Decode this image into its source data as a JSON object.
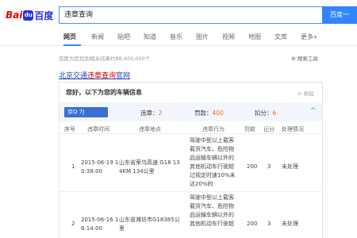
{
  "logo": {
    "bai": "Bai",
    "paw": "du",
    "du": "百度"
  },
  "search": {
    "query": "违章查询",
    "button": "百度一"
  },
  "tabs": [
    "网页",
    "新闻",
    "贴吧",
    "知道",
    "音乐",
    "图片",
    "视频",
    "地图",
    "文库",
    "更多»"
  ],
  "result_count": "百度为您找到相关结果约88,600,000个",
  "search_tools": "搜索工具",
  "result": {
    "title_pre": "北京交通",
    "title_hl": "违章查询",
    "title_post": "官网"
  },
  "card": {
    "heading": "您好，以下为您的车辆信息",
    "fold": "收起",
    "plate": "京Q 7J",
    "violations_label": "违章：",
    "violations": "2",
    "fine_label": "罚款：",
    "fine": "400",
    "points_label": "扣分：",
    "points": "6",
    "caret": "^",
    "headers": [
      "序号",
      "违章时间",
      "违章地点",
      "违章行为",
      "罚款",
      "记分",
      "处理情况"
    ],
    "rows": [
      {
        "no": "1",
        "time": [
          "2015-06-19 1",
          "3:38:00"
        ],
        "place": [
          "山东省荣乌高速 G18 13",
          "4KM 134公里"
        ],
        "behavior": [
          "驾驶中型以上载客",
          "载货汽车、危险物",
          "品运输车辆以外的",
          "其他机动车行驶超",
          "过规定时速10%未",
          "达20%的"
        ],
        "fine": "200",
        "points": "3",
        "status": "未处理"
      },
      {
        "no": "2",
        "time": [
          "2015-06-16 1",
          "6:14:00"
        ],
        "place": [
          "山东省潍坊市G18385公",
          "里"
        ],
        "behavior": [
          "驾驶中型以上载客",
          "载货汽车、危险物",
          "品运输车辆以外的",
          "其他机动车行驶超"
        ],
        "fine": "200",
        "points": "3",
        "status": "未处理"
      }
    ]
  }
}
